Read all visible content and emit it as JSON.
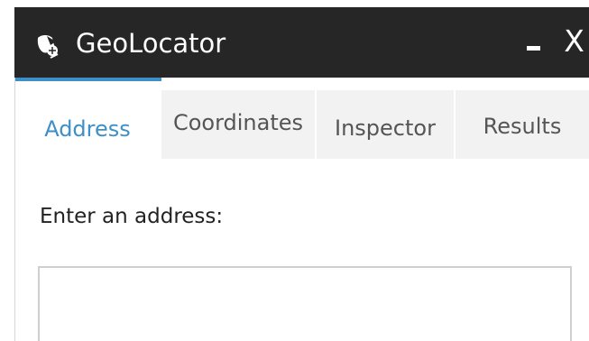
{
  "window": {
    "title": "GeoLocator",
    "icon": "geolocator-app-icon",
    "minimize_icon": "minimize-icon",
    "close_label": "X"
  },
  "tabs": [
    {
      "label": "Address",
      "active": true
    },
    {
      "label": "Coordinates",
      "active": false
    },
    {
      "label": "Inspector",
      "active": false
    },
    {
      "label": "Results",
      "active": false
    }
  ],
  "address_panel": {
    "prompt": "Enter an address:",
    "input_value": "",
    "input_placeholder": ""
  },
  "colors": {
    "title_bar": "#262626",
    "accent": "#3d8fc7",
    "inactive_tab": "#f2f2f2"
  }
}
